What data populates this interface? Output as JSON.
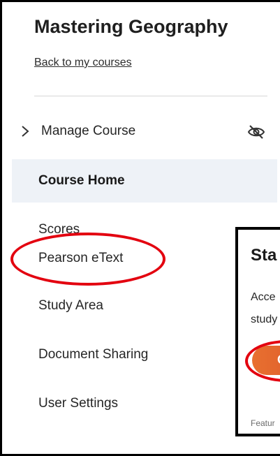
{
  "sidebar": {
    "title": "Mastering Geography",
    "back_link": "Back to my courses",
    "manage_course": {
      "label": "Manage Course",
      "chevron_icon": "chevron-right-icon",
      "visibility_icon": "eye-off-icon"
    },
    "items": [
      {
        "label": "Course Home",
        "active": true
      },
      {
        "label": "Scores",
        "active": false
      },
      {
        "label": "Pearson eText",
        "active": false,
        "highlighted": true
      },
      {
        "label": "Study Area",
        "active": false
      },
      {
        "label": "Document Sharing",
        "active": false
      },
      {
        "label": "User Settings",
        "active": false
      }
    ]
  },
  "card": {
    "title": "Sta",
    "line1": "Acce",
    "line2": "study",
    "button_label": "O",
    "footer": "Featur"
  },
  "colors": {
    "highlight_circle": "#e3000f",
    "active_item_bg": "#eef2f7",
    "button_start": "#e8702f",
    "button_end": "#d64c2c"
  }
}
